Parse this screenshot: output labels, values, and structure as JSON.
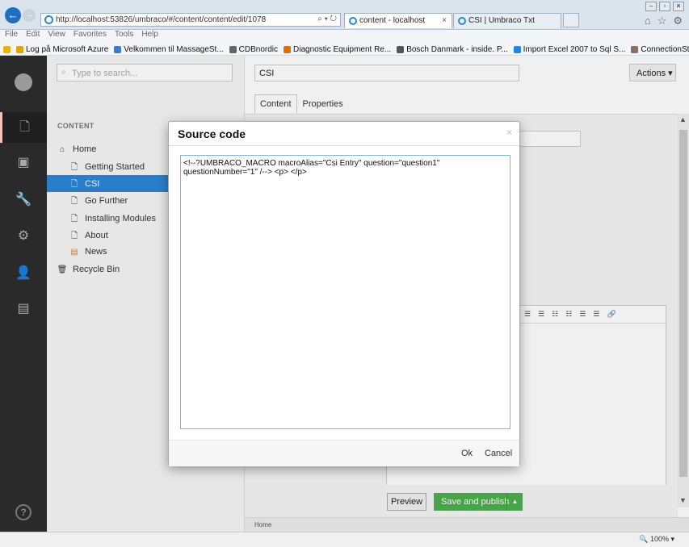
{
  "browser": {
    "address": "http://localhost:53826/umbraco/#/content/content/edit/1078",
    "address_host": "localhost",
    "tabs": [
      {
        "label": "content - localhost"
      },
      {
        "label": "CSI | Umbraco Txt"
      }
    ],
    "menu": [
      "File",
      "Edit",
      "View",
      "Favorites",
      "Tools",
      "Help"
    ],
    "favorites": [
      {
        "label": "Log på Microsoft Azure",
        "color": "#e2a400"
      },
      {
        "label": "Velkommen til MassageSt...",
        "color": "#3a7bd5"
      },
      {
        "label": "CDBnordic",
        "color": "#666666"
      },
      {
        "label": "Diagnostic Equipment Re...",
        "color": "#e86a00"
      },
      {
        "label": "Bosch Danmark - inside. P...",
        "color": "#555555"
      },
      {
        "label": "Import Excel 2007 to Sql S...",
        "color": "#1e88e5"
      },
      {
        "label": "ConnectionStrings.com - ...",
        "color": "#8d6e63"
      }
    ],
    "zoom": "100%"
  },
  "tree": {
    "search_placeholder": "Type to search...",
    "heading": "CONTENT",
    "items": [
      {
        "label": "Home",
        "icon": "home-icon"
      },
      {
        "label": "Getting Started",
        "icon": "document-icon"
      },
      {
        "label": "CSI",
        "icon": "document-icon"
      },
      {
        "label": "Go Further",
        "icon": "document-icon"
      },
      {
        "label": "Installing Modules",
        "icon": "document-icon"
      },
      {
        "label": "About",
        "icon": "document-icon"
      },
      {
        "label": "News",
        "icon": "news-icon"
      },
      {
        "label": "Recycle Bin",
        "icon": "trash-icon"
      }
    ]
  },
  "editor": {
    "name_value": "CSI",
    "actions_label": "Actions",
    "tabs": [
      "Content",
      "Properties"
    ],
    "preview_label": "Preview",
    "publish_label": "Save and publish",
    "breadcrumb": "Home"
  },
  "modal": {
    "title": "Source code",
    "close": "×",
    "code": "<!--?UMBRACO_MACRO macroAlias=\"Csi Entry\" question=\"question1\" questionNumber=\"1\" /--> <p> </p>",
    "ok_label": "Ok",
    "cancel_label": "Cancel"
  },
  "colors": {
    "selected": "#2b86d8",
    "publish": "#4caf50",
    "nav_bg": "#2a2a2a"
  }
}
